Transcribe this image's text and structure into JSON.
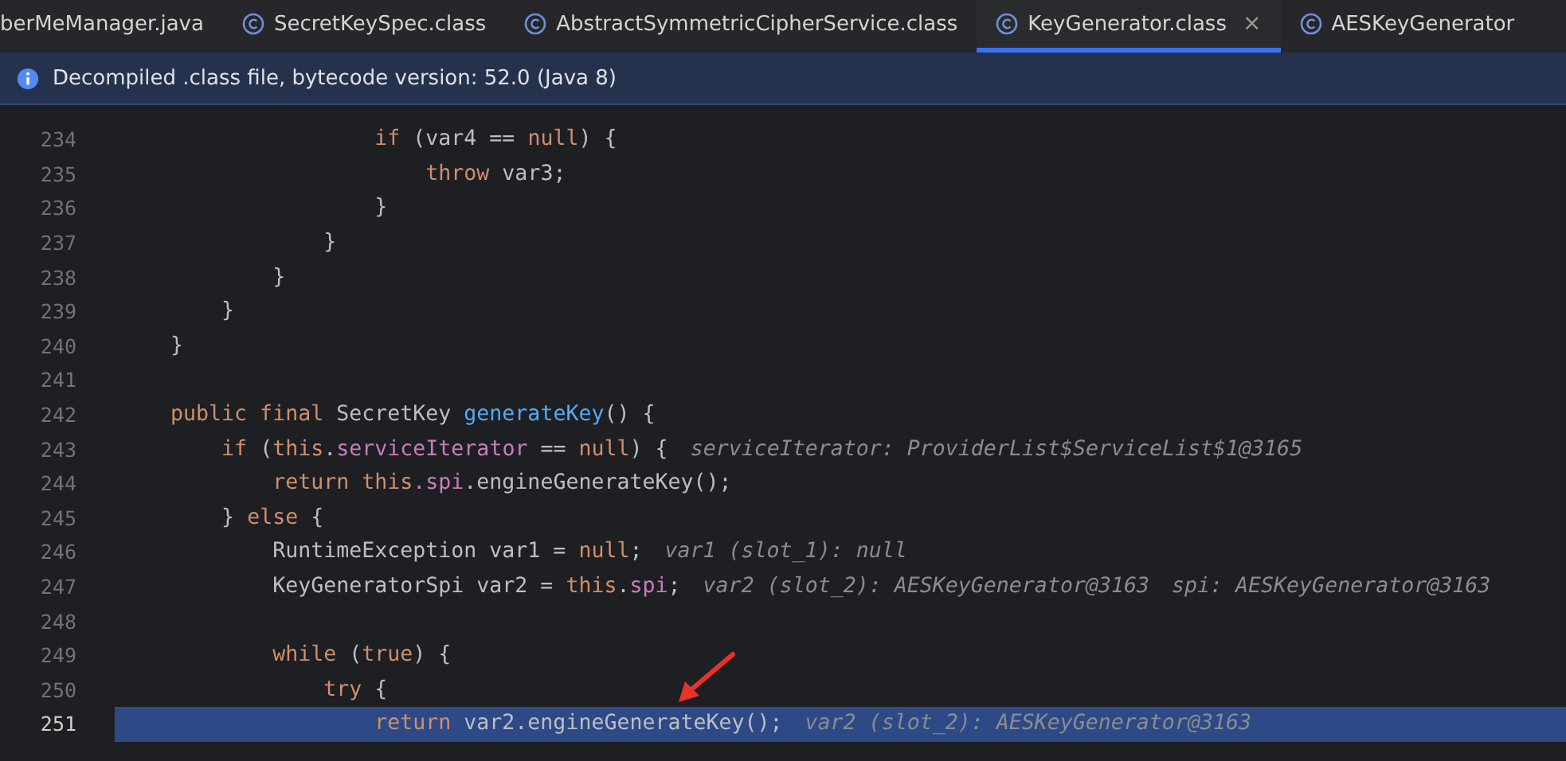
{
  "tabs": [
    {
      "label": "berMeManager.java",
      "icon": false,
      "selected": false,
      "closable": false
    },
    {
      "label": "SecretKeySpec.class",
      "icon": true,
      "selected": false,
      "closable": false
    },
    {
      "label": "AbstractSymmetricCipherService.class",
      "icon": true,
      "selected": false,
      "closable": false
    },
    {
      "label": "KeyGenerator.class",
      "icon": true,
      "selected": true,
      "closable": true,
      "close": "×"
    },
    {
      "label": "AESKeyGenerator",
      "icon": true,
      "selected": false,
      "closable": false
    }
  ],
  "banner": {
    "text": "Decompiled .class file, bytecode version: 52.0 (Java 8)"
  },
  "lines": [
    {
      "number": "234",
      "highlighted": false,
      "tokens": [
        {
          "text": "                    if",
          "kind": "kw"
        },
        {
          "text": " (var4 == ",
          "kind": "plain"
        },
        {
          "text": "null",
          "kind": "kw"
        },
        {
          "text": ") {",
          "kind": "plain"
        }
      ]
    },
    {
      "number": "235",
      "highlighted": false,
      "tokens": [
        {
          "text": "                        throw",
          "kind": "kw"
        },
        {
          "text": " var3;",
          "kind": "plain"
        }
      ]
    },
    {
      "number": "236",
      "highlighted": false,
      "tokens": [
        {
          "text": "                    }",
          "kind": "plain"
        }
      ]
    },
    {
      "number": "237",
      "highlighted": false,
      "tokens": [
        {
          "text": "                }",
          "kind": "plain"
        }
      ]
    },
    {
      "number": "238",
      "highlighted": false,
      "tokens": [
        {
          "text": "            }",
          "kind": "plain"
        }
      ]
    },
    {
      "number": "239",
      "highlighted": false,
      "tokens": [
        {
          "text": "        }",
          "kind": "plain"
        }
      ]
    },
    {
      "number": "240",
      "highlighted": false,
      "tokens": [
        {
          "text": "    }",
          "kind": "plain"
        }
      ]
    },
    {
      "number": "241",
      "highlighted": false
    },
    {
      "number": "242",
      "highlighted": false,
      "tokens": [
        {
          "text": "    public final",
          "kind": "kw"
        },
        {
          "text": " SecretKey ",
          "kind": "plain"
        },
        {
          "text": "generateKey",
          "kind": "method"
        },
        {
          "text": "() {",
          "kind": "plain"
        }
      ]
    },
    {
      "number": "243",
      "highlighted": false,
      "tokens": [
        {
          "text": "        if",
          "kind": "kw"
        },
        {
          "text": " (",
          "kind": "plain"
        },
        {
          "text": "this",
          "kind": "kw"
        },
        {
          "text": ".",
          "kind": "plain"
        },
        {
          "text": "serviceIterator",
          "kind": "field"
        },
        {
          "text": " == ",
          "kind": "plain"
        },
        {
          "text": "null",
          "kind": "kw"
        },
        {
          "text": ") {",
          "kind": "plain"
        }
      ],
      "hints": [
        "serviceIterator: ProviderList$ServiceList$1@3165"
      ]
    },
    {
      "number": "244",
      "highlighted": false,
      "tokens": [
        {
          "text": "            return this",
          "kind": "kw"
        },
        {
          "text": ".spi",
          "kind": "field"
        },
        {
          "text": ".engineGenerateKey();",
          "kind": "plain"
        }
      ]
    },
    {
      "number": "245",
      "highlighted": false,
      "tokens": [
        {
          "text": "        } ",
          "kind": "plain"
        },
        {
          "text": "else",
          "kind": "kw"
        },
        {
          "text": " {",
          "kind": "plain"
        }
      ]
    },
    {
      "number": "246",
      "highlighted": false,
      "tokens": [
        {
          "text": "            RuntimeException var1 = ",
          "kind": "plain"
        },
        {
          "text": "null",
          "kind": "kw"
        },
        {
          "text": ";",
          "kind": "plain"
        }
      ],
      "hints": [
        "var1 (slot_1): null"
      ]
    },
    {
      "number": "247",
      "highlighted": false,
      "tokens": [
        {
          "text": "            KeyGeneratorSpi var2 = ",
          "kind": "plain"
        },
        {
          "text": "this",
          "kind": "kw"
        },
        {
          "text": ".",
          "kind": "plain"
        },
        {
          "text": "spi",
          "kind": "field"
        },
        {
          "text": ";",
          "kind": "plain"
        }
      ],
      "hints": [
        "var2 (slot_2): AESKeyGenerator@3163",
        "spi: AESKeyGenerator@3163"
      ]
    },
    {
      "number": "248",
      "highlighted": false
    },
    {
      "number": "249",
      "highlighted": false,
      "tokens": [
        {
          "text": "            while",
          "kind": "kw"
        },
        {
          "text": " (",
          "kind": "plain"
        },
        {
          "text": "true",
          "kind": "kw"
        },
        {
          "text": ") {",
          "kind": "plain"
        }
      ]
    },
    {
      "number": "250",
      "highlighted": false,
      "tokens": [
        {
          "text": "                try",
          "kind": "kw"
        },
        {
          "text": " {",
          "kind": "plain"
        }
      ]
    },
    {
      "number": "251",
      "highlighted": true,
      "tokens": [
        {
          "text": "                    return",
          "kind": "kw"
        },
        {
          "text": " var2.engineGenerateKey();",
          "kind": "plain"
        }
      ],
      "hints": [
        "var2 (slot_2): AESKeyGenerator@3163"
      ]
    }
  ]
}
